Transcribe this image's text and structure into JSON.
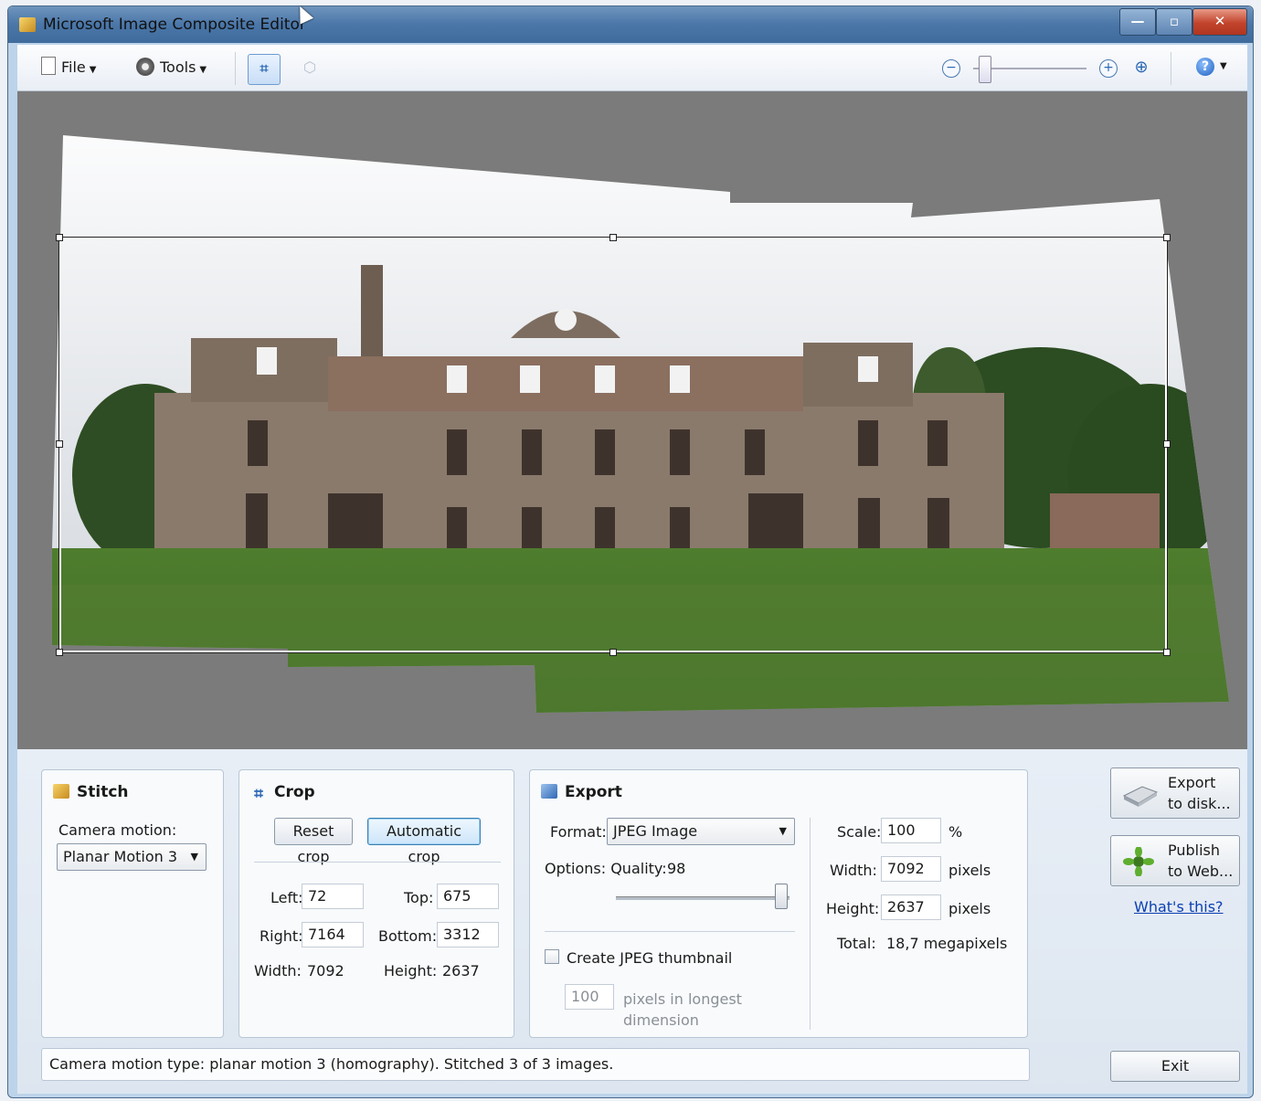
{
  "window": {
    "title": "Microsoft Image Composite Editor"
  },
  "toolbar": {
    "file_label": "File",
    "tools_label": "Tools",
    "zoom_level": 0.05
  },
  "stitch": {
    "title": "Stitch",
    "camera_motion_label": "Camera motion:",
    "camera_motion_value": "Planar Motion 3"
  },
  "crop": {
    "title": "Crop",
    "reset_label": "Reset crop",
    "auto_label": "Automatic crop",
    "left_label": "Left:",
    "left_value": "72",
    "top_label": "Top:",
    "top_value": "675",
    "right_label": "Right:",
    "right_value": "7164",
    "bottom_label": "Bottom:",
    "bottom_value": "3312",
    "width_label": "Width:",
    "width_value": "7092",
    "height_label": "Height:",
    "height_value": "2637"
  },
  "export": {
    "title": "Export",
    "format_label": "Format:",
    "format_value": "JPEG Image",
    "options_label": "Options: Quality:",
    "quality_value": "98",
    "thumb_label": "Create JPEG thumbnail",
    "thumb_size": "100",
    "thumb_unit_1": "pixels in longest",
    "thumb_unit_2": "dimension",
    "scale_label": "Scale:",
    "scale_value": "100",
    "scale_unit": "%",
    "width_label": "Width:",
    "width_value": "7092",
    "width_unit": "pixels",
    "height_label": "Height:",
    "height_value": "2637",
    "height_unit": "pixels",
    "total_label": "Total:",
    "total_value": "18,7 megapixels"
  },
  "actions": {
    "export_disk_1": "Export",
    "export_disk_2": "to disk...",
    "publish_1": "Publish",
    "publish_2": "to Web...",
    "whats_this": "What's this?",
    "exit": "Exit"
  },
  "status": "Camera motion type: planar motion 3 (homography). Stitched 3 of 3 images."
}
